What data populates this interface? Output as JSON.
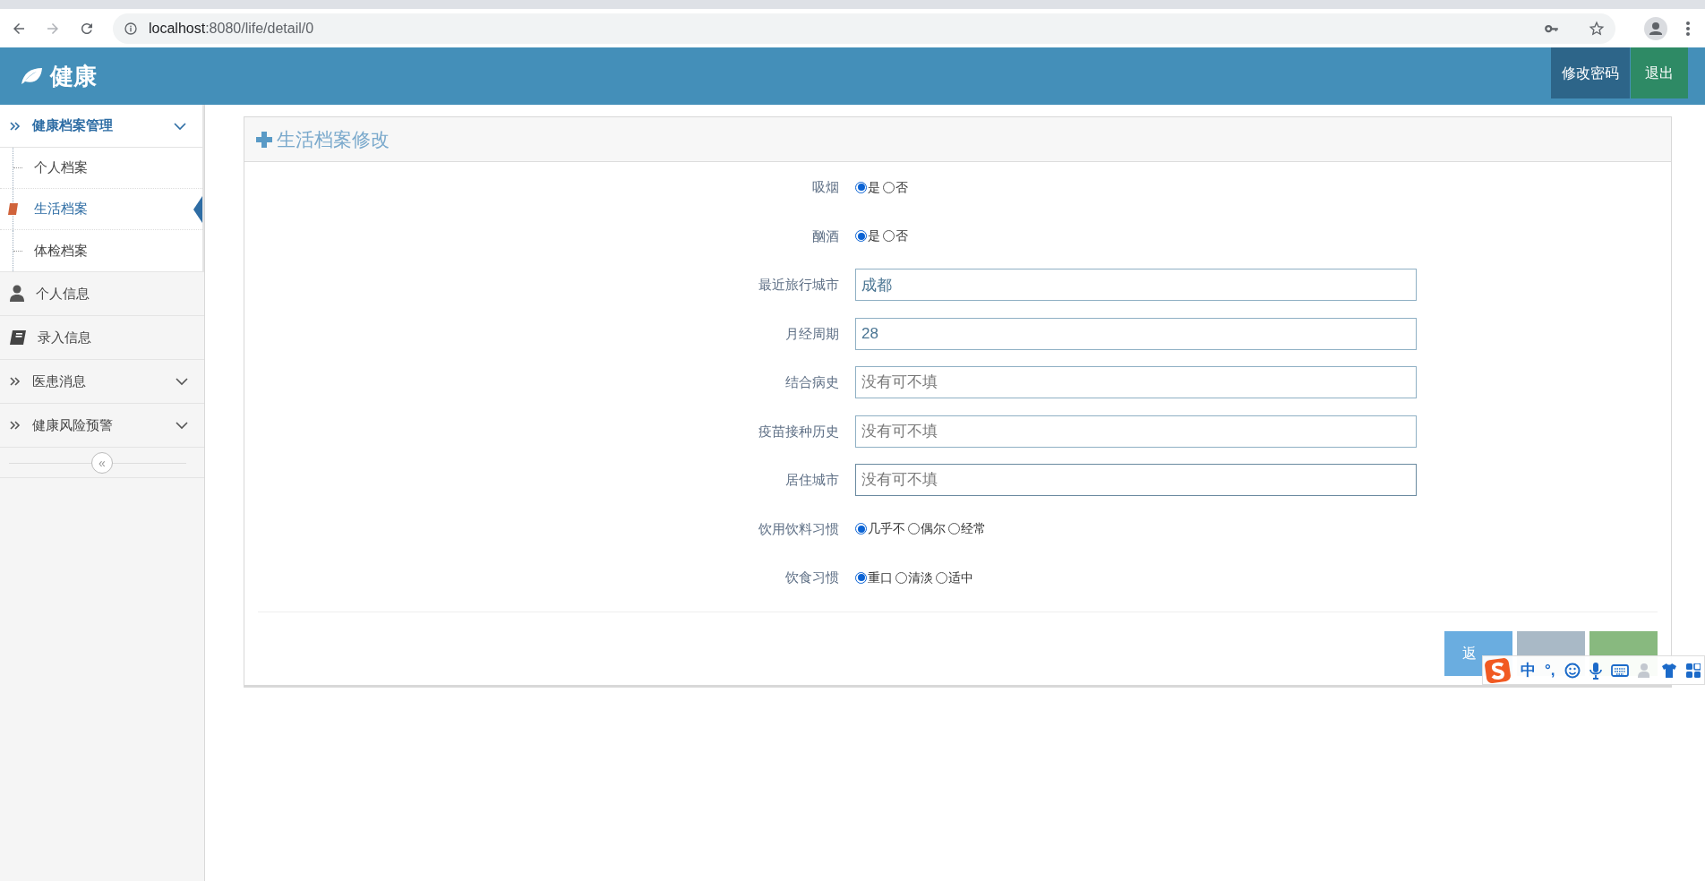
{
  "browser": {
    "url_host": "localhost",
    "url_path": ":8080/life/detail/0"
  },
  "header": {
    "logo": "健康",
    "buttons": [
      {
        "label": "修改密码",
        "kind": "primary"
      },
      {
        "label": "退出",
        "kind": "success"
      }
    ]
  },
  "sidebar": {
    "items": [
      {
        "label": "健康档案管理",
        "kind": "menu",
        "expanded": true,
        "collapsible": true,
        "children": [
          {
            "label": "个人档案",
            "selected": false
          },
          {
            "label": "生活档案",
            "selected": true
          },
          {
            "label": "体检档案",
            "selected": false
          }
        ]
      },
      {
        "label": "个人信息",
        "kind": "user"
      },
      {
        "label": "录入信息",
        "kind": "book"
      },
      {
        "label": "医患消息",
        "kind": "menu",
        "expanded": false,
        "collapsible": true
      },
      {
        "label": "健康风险预警",
        "kind": "menu",
        "expanded": false,
        "collapsible": true
      }
    ],
    "collapse_button": "«"
  },
  "panel": {
    "title": "生活档案修改",
    "fields": [
      {
        "label": "吸烟",
        "kind": "radio",
        "options": [
          {
            "label": "是",
            "selected": true
          },
          {
            "label": "否",
            "selected": false
          }
        ]
      },
      {
        "label": "酗酒",
        "kind": "radio",
        "options": [
          {
            "label": "是",
            "selected": true
          },
          {
            "label": "否",
            "selected": false
          }
        ]
      },
      {
        "label": "最近旅行城市",
        "kind": "input",
        "value": "成都"
      },
      {
        "label": "月经周期",
        "kind": "input",
        "value": "28"
      },
      {
        "label": "结合病史",
        "kind": "input",
        "placeholder": "没有可不填"
      },
      {
        "label": "疫苗接种历史",
        "kind": "input",
        "placeholder": "没有可不填"
      },
      {
        "label": "居住城市",
        "kind": "input",
        "placeholder": "没有可不填",
        "focused": true
      },
      {
        "label": "饮用饮料习惯",
        "kind": "radio",
        "options": [
          {
            "label": "几乎不",
            "selected": true
          },
          {
            "label": "偶尔",
            "selected": false
          },
          {
            "label": "经常",
            "selected": false
          }
        ]
      },
      {
        "label": "饮食习惯",
        "kind": "radio",
        "options": [
          {
            "label": "重口",
            "selected": true
          },
          {
            "label": "清淡",
            "selected": false
          },
          {
            "label": "适中",
            "selected": false
          }
        ]
      }
    ],
    "buttons": [
      {
        "label": "返",
        "kind": "back"
      },
      {
        "kind": "reset"
      },
      {
        "kind": "submit"
      }
    ]
  },
  "ime_toolbar": {
    "mode": "中",
    "punct": "°,"
  }
}
